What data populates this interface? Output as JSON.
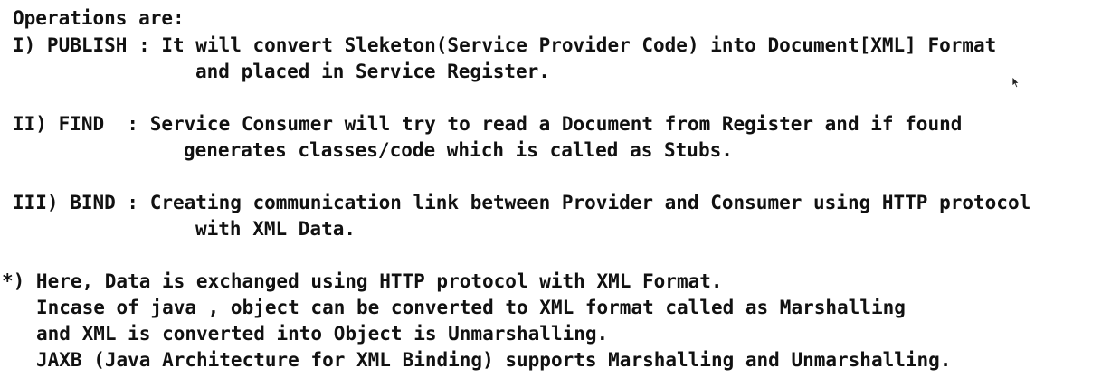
{
  "intro": "Operations are:",
  "publish": {
    "line1": "I) PUBLISH : It will convert Sleketon(Service Provider Code) into Document[XML] Format",
    "line2": "and placed in Service Register."
  },
  "find": {
    "line1": "II) FIND  : Service Consumer will try to read a Document from Register and if found",
    "line2": "generates classes/code which is called as Stubs."
  },
  "bind": {
    "line1": "III) BIND : Creating communication link between Provider and Consumer using HTTP protocol",
    "line2": "with XML Data."
  },
  "note": {
    "line1": "*) Here, Data is exchanged using HTTP protocol with XML Format.",
    "line2": "Incase of java , object can be converted to XML format called as Marshalling",
    "line3": "and XML is converted into Object is Unmarshalling.",
    "line4": "JAXB (Java Architecture for XML Binding) supports Marshalling and Unmarshalling."
  },
  "colors": {
    "text": "#111111",
    "background": "#ffffff"
  },
  "icons": {
    "cursor": "mouse-pointer-icon"
  }
}
